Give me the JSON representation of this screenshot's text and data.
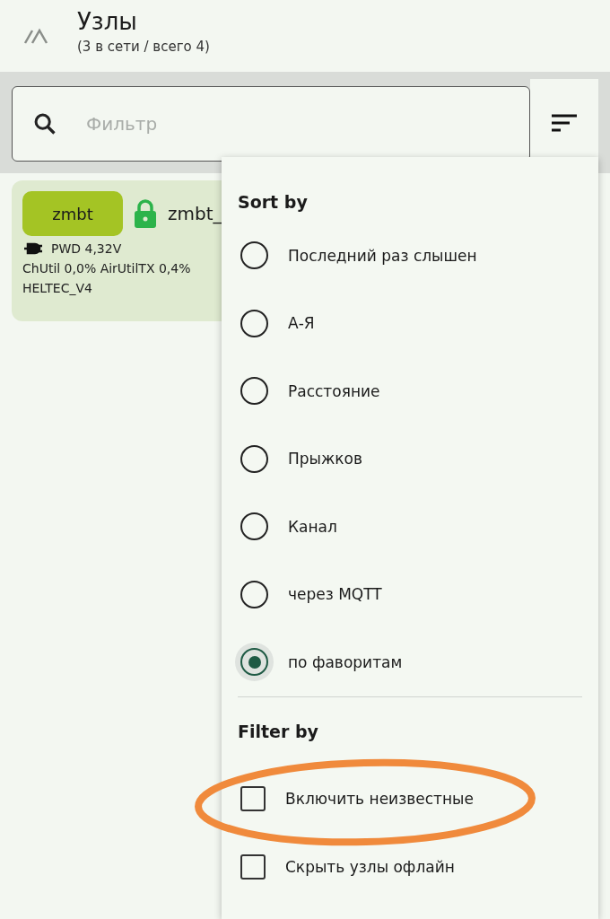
{
  "header": {
    "title": "Узлы",
    "subtitle": "(3 в сети / всего 4)"
  },
  "filter": {
    "placeholder": "Фильтр"
  },
  "node": {
    "short_name": "zmbt",
    "locked": true,
    "long_name": "zmbt_",
    "power": "PWD 4,32V",
    "stats": "ChUtil 0,0% AirUtilTX 0,4%",
    "hardware": "HELTEC_V4"
  },
  "sort_menu": {
    "heading": "Sort by",
    "options": [
      {
        "label": "Последний раз слышен",
        "selected": false
      },
      {
        "label": "А-Я",
        "selected": false
      },
      {
        "label": "Расстояние",
        "selected": false
      },
      {
        "label": "Прыжков",
        "selected": false
      },
      {
        "label": "Канал",
        "selected": false
      },
      {
        "label": "через MQTT",
        "selected": false
      },
      {
        "label": "по фаворитам",
        "selected": true
      }
    ],
    "filter_heading": "Filter by",
    "filters": [
      {
        "label": "Включить неизвестные",
        "checked": false
      },
      {
        "label": "Скрыть узлы офлайн",
        "checked": false
      }
    ]
  }
}
